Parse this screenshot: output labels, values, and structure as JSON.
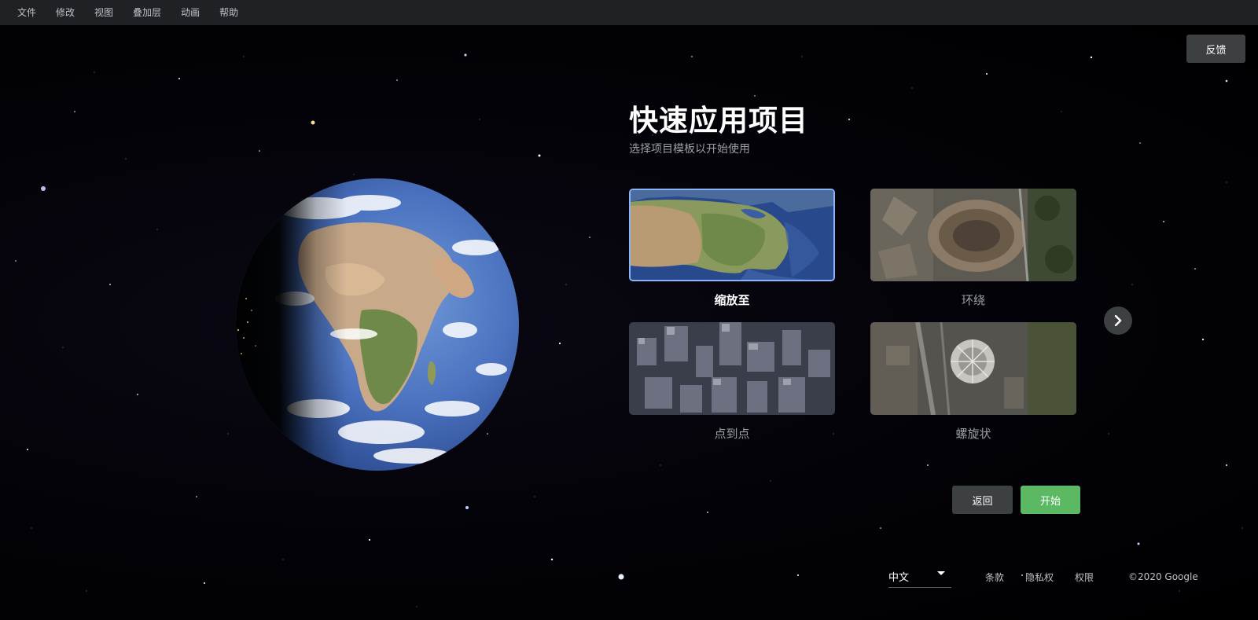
{
  "menu": {
    "items": [
      "文件",
      "修改",
      "视图",
      "叠加层",
      "动画",
      "帮助"
    ]
  },
  "feedback_label": "反馈",
  "wizard": {
    "title": "快速应用项目",
    "subtitle": "选择项目模板以开始使用",
    "templates": [
      {
        "label": "缩放至",
        "selected": true,
        "thumb": "map-north-america"
      },
      {
        "label": "环绕",
        "selected": false,
        "thumb": "colosseum-aerial"
      },
      {
        "label": "点到点",
        "selected": false,
        "thumb": "city-skyscrapers"
      },
      {
        "label": "螺旋状",
        "selected": false,
        "thumb": "stadium-aerial"
      }
    ],
    "back_label": "返回",
    "start_label": "开始"
  },
  "footer": {
    "language": "中文",
    "links": [
      "条款",
      "隐私权",
      "权限"
    ],
    "copyright": "©2020 Google"
  },
  "colors": {
    "accent_selected": "#8ab4f8",
    "start_button": "#5bb863",
    "menubar_bg": "#202124",
    "button_dark": "#3c4043"
  }
}
